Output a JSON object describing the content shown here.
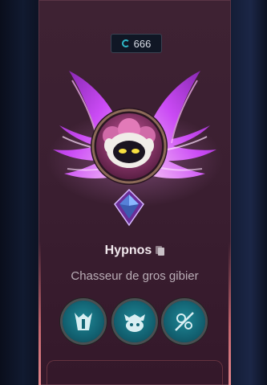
{
  "currency": {
    "icon": "blue-essence-icon",
    "value": "666"
  },
  "profile": {
    "name": "Hypnos",
    "title": "Chasseur de gros gibier",
    "copy_icon": "copy-icon"
  },
  "emotes": [
    {
      "icon": "horned-helmet-icon"
    },
    {
      "icon": "poro-viking-icon"
    },
    {
      "icon": "crossed-target-icon"
    }
  ],
  "colors": {
    "card": "#3b1f31",
    "wing": "#d040ff",
    "emote": "#136474",
    "accent_cyan": "#2fb8c8"
  }
}
